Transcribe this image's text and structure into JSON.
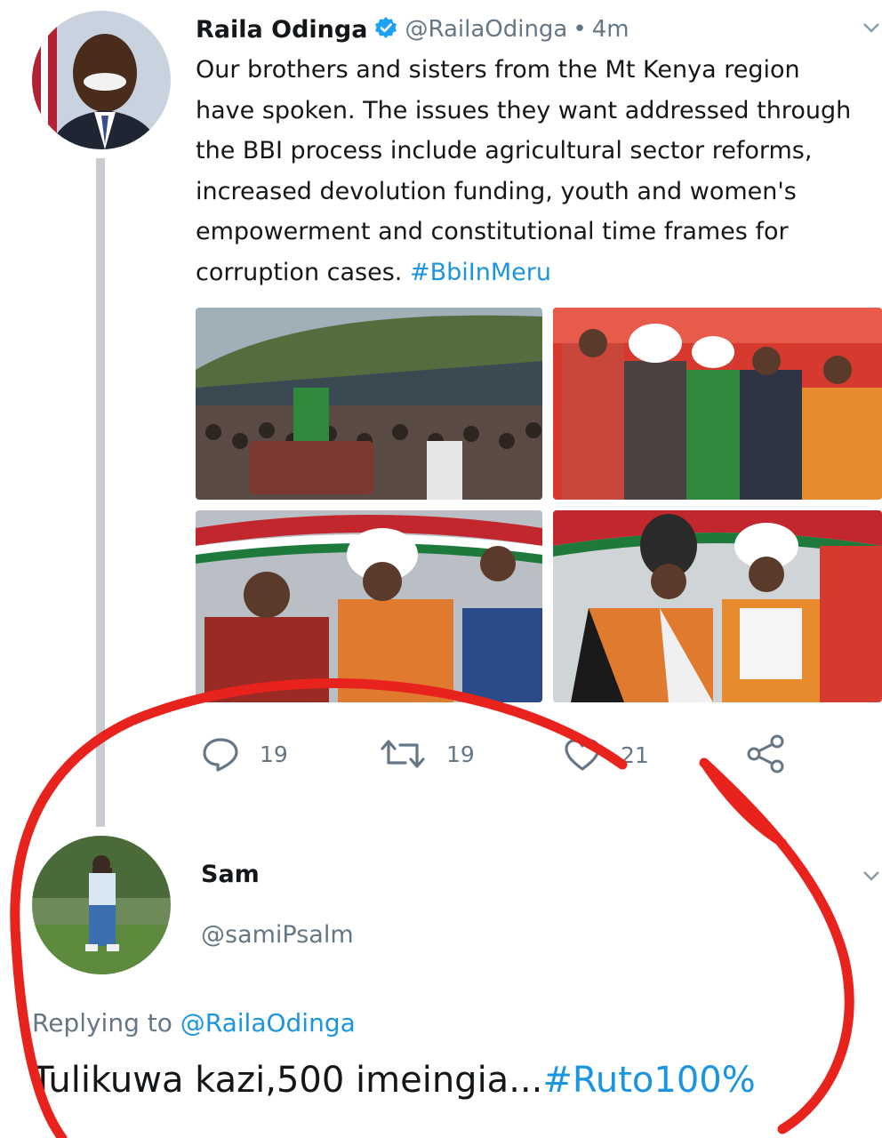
{
  "tweet": {
    "author_name": "Raila Odinga",
    "author_handle": "@RailaOdinga",
    "separator": "•",
    "time": "4m",
    "text": "Our brothers and sisters from the Mt Kenya region\nhave spoken. The issues they want addressed through\nthe BBI process include agricultural sector reforms,\nincreased devolution funding, youth and women's\nempowerment and constitutional time frames for\ncorruption cases. ",
    "hashtag": "#BbiInMeru",
    "photos": [
      "stadium-rally-photo",
      "leaders-with-microphone-photo",
      "leaders-seated-photo",
      "elders-in-traditional-attire-photo"
    ],
    "actions": {
      "reply_count": "19",
      "retweet_count": "19",
      "like_count": "21"
    }
  },
  "reply": {
    "author_name": "Sam",
    "author_handle": "@samiPsalm",
    "replying_label": "Replying to ",
    "replying_mention": "@RailaOdinga",
    "text": "Tulikuwa kazi,500 imeingia...",
    "hashtag": "#Ruto100%"
  },
  "colors": {
    "link_blue": "#1b95e0",
    "secondary_text": "#657786",
    "annotation_red": "#e8231d"
  }
}
